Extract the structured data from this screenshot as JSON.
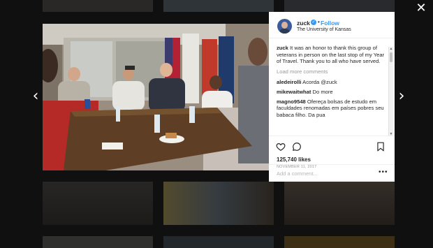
{
  "post": {
    "username": "zuck",
    "follow_label": "Follow",
    "dot": "•",
    "location": "The University of Kansas",
    "caption_user": "zuck",
    "caption_text": "It was an honor to thank this group of veterans in person on the last stop of my Year of Travel. Thank you to all who have served.",
    "load_more": "Load more comments",
    "comments": [
      {
        "user": "aledeirolli",
        "text": "Acorda @zuck"
      },
      {
        "user": "mikewaitwhat",
        "text": "Do more"
      },
      {
        "user": "magno9548",
        "text": "Ofereça bolsas de estudo em faculdades renomadas em países pobres seu babaca filho. Da pua"
      }
    ],
    "likes": "125,740 likes",
    "date": "NOVEMBER 11, 2017",
    "add_comment_placeholder": "Add a comment...",
    "more_options": "•••"
  },
  "nav": {
    "close": "✕",
    "prev": "‹",
    "next": "›"
  },
  "icons": {
    "close": "close-icon",
    "prev": "chevron-left-icon",
    "next": "chevron-right-icon",
    "like": "heart-icon",
    "comment": "comment-bubble-icon",
    "save": "bookmark-icon",
    "verified": "verified-badge-icon"
  },
  "colors": {
    "accent": "#3897f0",
    "text": "#262626",
    "muted": "#999999"
  }
}
